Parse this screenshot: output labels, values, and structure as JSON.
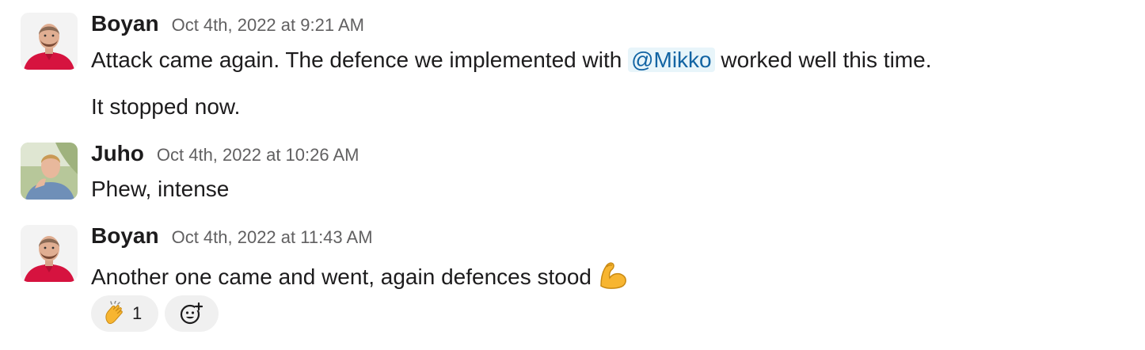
{
  "messages": [
    {
      "author": "Boyan",
      "timestamp": "Oct 4th, 2022 at 9:21 AM",
      "avatar": "avatar-boyan",
      "line1_before": "Attack came again. The defence we implemented with ",
      "line1_mention": "@Mikko",
      "line1_after": " worked well this time.",
      "line2": "It stopped now."
    },
    {
      "author": "Juho",
      "timestamp": "Oct 4th, 2022 at 10:26 AM",
      "avatar": "avatar-juho",
      "line1": "Phew, intense"
    },
    {
      "author": "Boyan",
      "timestamp": "Oct 4th, 2022 at 11:43 AM",
      "avatar": "avatar-boyan",
      "line1": "Another one came and went, again defences stood",
      "emoji": "flexed-biceps-icon"
    }
  ],
  "reactions": [
    {
      "emoji": "clapping-hands-icon",
      "count": "1"
    }
  ],
  "add_reaction": {
    "icon": "add-reaction-icon"
  },
  "colors": {
    "mention_bg": "#e8f5fa",
    "mention_text": "#1264a3",
    "timestamp": "#616061",
    "reaction_bg": "#f0f0f0"
  }
}
